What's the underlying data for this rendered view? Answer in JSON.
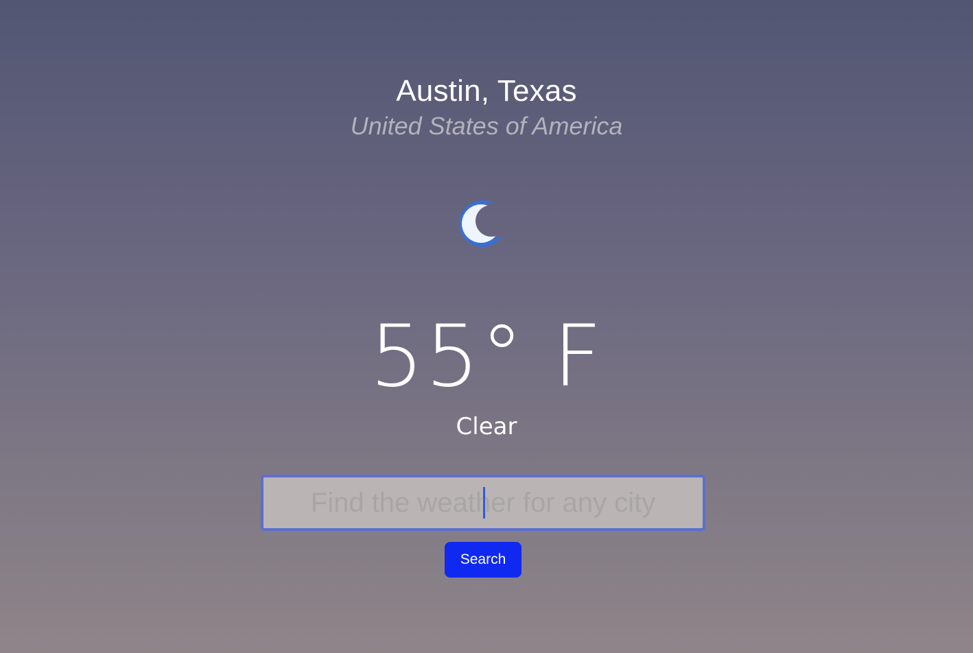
{
  "location": {
    "city": "Austin, Texas",
    "country": "United States of America"
  },
  "weather": {
    "icon": "crescent-moon-icon",
    "temperature": "55° F",
    "condition": "Clear"
  },
  "search": {
    "placeholder": "Find the weather for any city",
    "value": "",
    "button_label": "Search"
  },
  "colors": {
    "button": "#1029f0",
    "input_border": "#5b6fcf",
    "moon_outer": "#3a6fd0",
    "moon_inner": "#eef5ff"
  }
}
